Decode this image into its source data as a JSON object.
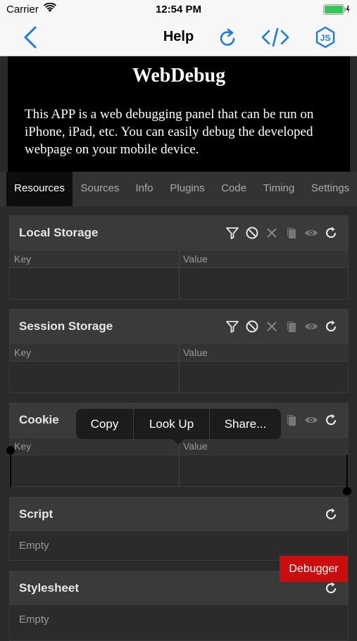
{
  "status_bar": {
    "carrier": "Carrier",
    "time": "12:54 PM"
  },
  "nav": {
    "title": "Help"
  },
  "colors": {
    "accent": "#1a7ae8",
    "debugger": "#cc0d0d",
    "panel_header": "#3a3a3a"
  },
  "web_content": {
    "title": "WebDebug",
    "description": "This APP is a web debugging panel that can be run on iPhone, iPad, etc. You can easily debug the developed webpage on your mobile device."
  },
  "tabs": [
    {
      "label": "Resources",
      "active": true
    },
    {
      "label": "Sources"
    },
    {
      "label": "Info"
    },
    {
      "label": "Plugins"
    },
    {
      "label": "Code"
    },
    {
      "label": "Timing"
    },
    {
      "label": "Settings"
    }
  ],
  "panels": {
    "local_storage": {
      "title": "Local Storage",
      "key_header": "Key",
      "value_header": "Value"
    },
    "session_storage": {
      "title": "Session Storage",
      "key_header": "Key",
      "value_header": "Value"
    },
    "cookie": {
      "title": "Cookie",
      "key_header": "Key",
      "value_header": "Value"
    },
    "script": {
      "title": "Script",
      "empty": "Empty"
    },
    "stylesheet": {
      "title": "Stylesheet",
      "empty": "Empty"
    }
  },
  "context_menu": {
    "copy": "Copy",
    "look_up": "Look Up",
    "share": "Share..."
  },
  "debugger_button": "Debugger",
  "icons": [
    "wifi-icon",
    "battery-icon",
    "back-chevron-icon",
    "refresh-icon",
    "code-icon",
    "js-icon",
    "filter-icon",
    "clear-icon",
    "close-icon",
    "copy-icon",
    "eye-icon"
  ]
}
